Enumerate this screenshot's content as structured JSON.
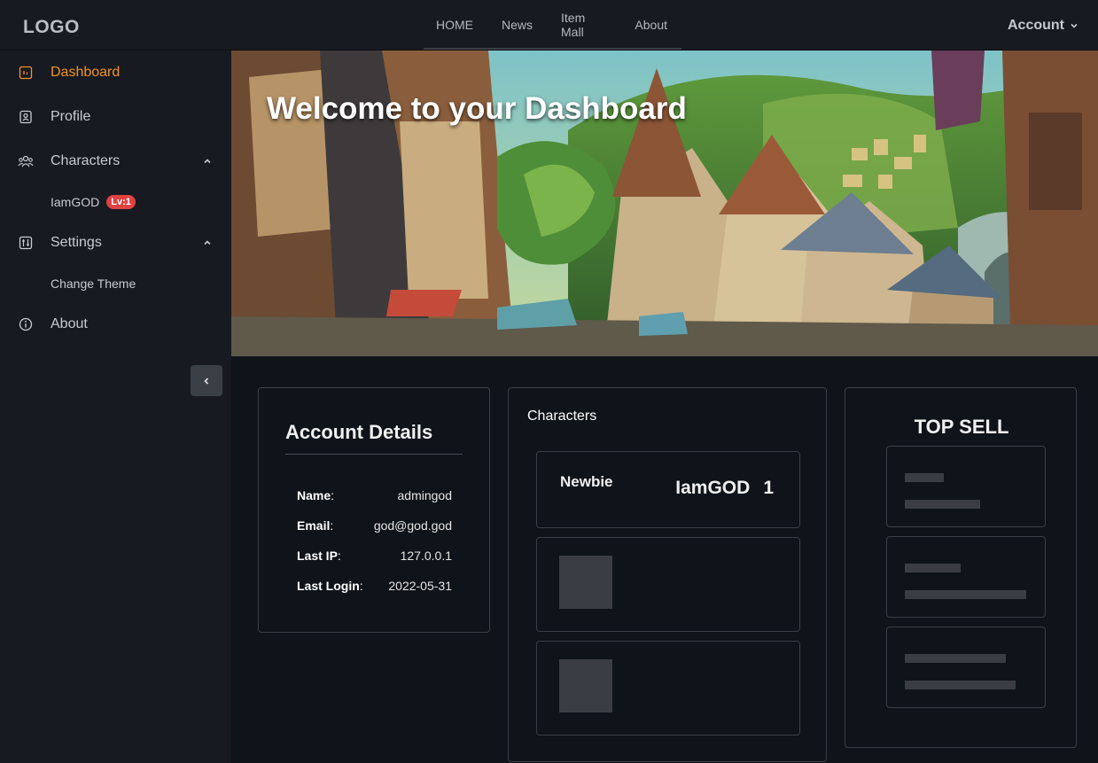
{
  "header": {
    "logo": "LOGO",
    "nav": [
      "HOME",
      "News",
      "Item Mall",
      "About"
    ],
    "account_label": "Account"
  },
  "sidebar": {
    "items": [
      {
        "label": "Dashboard",
        "icon": "dashboard-icon",
        "active": true
      },
      {
        "label": "Profile",
        "icon": "profile-icon"
      },
      {
        "label": "Characters",
        "icon": "users-icon",
        "expanded": true
      },
      {
        "label": "Settings",
        "icon": "sliders-icon",
        "expanded": true
      },
      {
        "label": "About",
        "icon": "info-icon"
      }
    ],
    "characters_sub": {
      "name": "IamGOD",
      "badge": "Lv:1"
    },
    "settings_sub": {
      "label": "Change Theme"
    },
    "accent_color": "#f39322"
  },
  "hero": {
    "title": "Welcome to your Dashboard"
  },
  "account_details": {
    "title": "Account Details",
    "rows": [
      {
        "key": "Name",
        "value": "admingod"
      },
      {
        "key": "Email",
        "value": "god@god.god"
      },
      {
        "key": "Last IP",
        "value": "127.0.0.1"
      },
      {
        "key": "Last Login",
        "value": "2022-05-31"
      }
    ]
  },
  "characters": {
    "title": "Characters",
    "list": [
      {
        "rank": "Newbie",
        "name": "IamGOD",
        "level": "1"
      }
    ]
  },
  "top_sell": {
    "title": "TOP SELL"
  }
}
